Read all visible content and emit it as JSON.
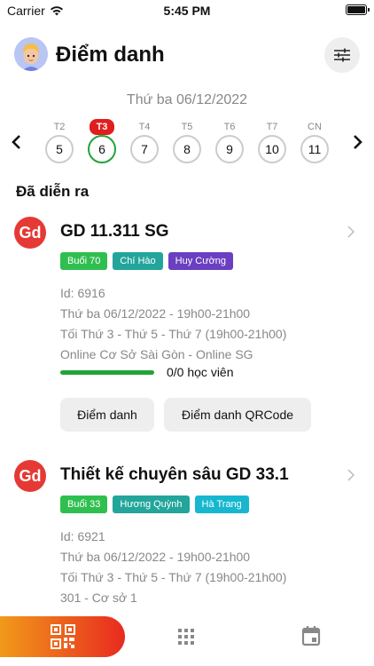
{
  "status_bar": {
    "carrier": "Carrier",
    "time": "5:45 PM"
  },
  "header": {
    "title": "Điểm danh"
  },
  "date_label": "Thứ ba 06/12/2022",
  "week": [
    {
      "name": "T2",
      "num": "5"
    },
    {
      "name": "T3",
      "num": "6"
    },
    {
      "name": "T4",
      "num": "7"
    },
    {
      "name": "T5",
      "num": "8"
    },
    {
      "name": "T6",
      "num": "9"
    },
    {
      "name": "T7",
      "num": "10"
    },
    {
      "name": "CN",
      "num": "11"
    }
  ],
  "section_title": "Đã diễn ra",
  "classes": [
    {
      "logo": "Gd",
      "name": "GD 11.311 SG",
      "tags": [
        "Buổi 70",
        "Chí Hào",
        "Huy Cường"
      ],
      "id": "Id: 6916",
      "date": "Thứ ba 06/12/2022 - 19h00-21h00",
      "schedule": "Tối Thứ 3 - Thứ 5 - Thứ 7 (19h00-21h00)",
      "location": "Online Cơ Sở Sài Gòn - Online SG",
      "students": "0/0 học viên",
      "attendance_button": "Điểm danh",
      "qr_button": "Điểm danh QRCode"
    },
    {
      "logo": "Gd",
      "name": "Thiết kế chuyên sâu GD 33.1",
      "tags": [
        "Buổi 33",
        "Hương Quỳnh",
        "Hà Trang"
      ],
      "id": "Id: 6921",
      "date": "Thứ ba 06/12/2022 - 19h00-21h00",
      "schedule": "Tối Thứ 3 - Thứ 5 - Thứ 7 (19h00-21h00)",
      "location": "301 - Cơ sở 1"
    }
  ],
  "colors": {
    "tag_green": "#2fbf4f",
    "tag_teal": "#23a59b",
    "tag_purple": "#6a3fc1",
    "tag_cyan": "#16b7cf",
    "accent_red": "#e01e1e",
    "progress_green": "#22a33a",
    "gradient_start": "#f19a1a",
    "gradient_end": "#e82a1f"
  },
  "icons": {
    "filter": "sliders-icon",
    "qr": "qr-code-icon",
    "grid": "grid-icon",
    "calendar": "calendar-icon"
  }
}
